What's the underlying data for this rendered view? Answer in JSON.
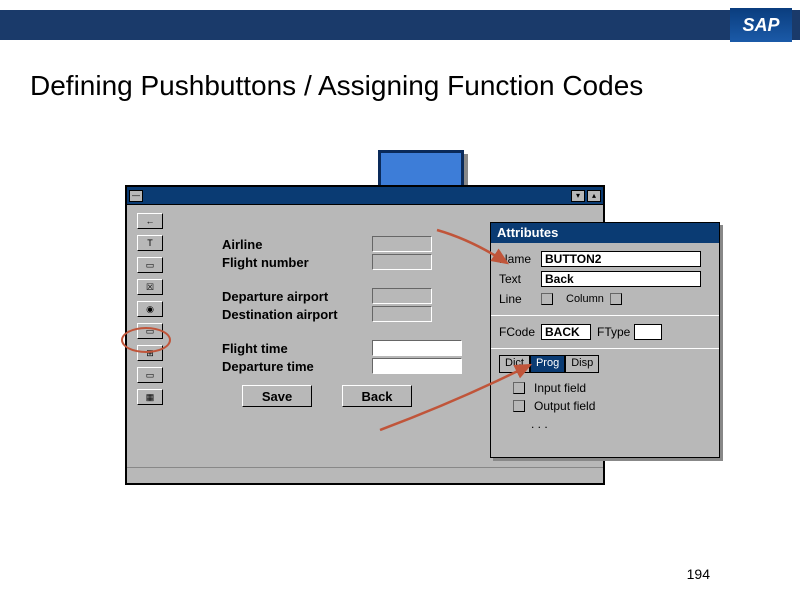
{
  "brand": "SAP",
  "slide_title": "Defining Pushbuttons / Assigning Function Codes",
  "page_number": "194",
  "form": {
    "fields": {
      "airline": "Airline",
      "flight_number": "Flight number",
      "dep_airport": "Departure airport",
      "dest_airport": "Destination airport",
      "flight_time": "Flight time",
      "dep_time": "Departure time"
    },
    "buttons": {
      "save": "Save",
      "back": "Back"
    }
  },
  "attributes": {
    "panel_title": "Attributes",
    "labels": {
      "name": "Name",
      "text": "Text",
      "line": "Line",
      "column": "Column",
      "fcode": "FCode",
      "ftype": "FType"
    },
    "values": {
      "name": "BUTTON2",
      "text": "Back",
      "fcode": "BACK",
      "ftype": ""
    },
    "tabs": {
      "dict": "Dict",
      "prog": "Prog",
      "disp": "Disp"
    },
    "options": {
      "input_field": "Input field",
      "output_field": "Output field",
      "more": ". . ."
    }
  },
  "toolbar_icons": [
    "arrow-left",
    "text",
    "frame",
    "checkbox",
    "radio",
    "button",
    "layout",
    "rect",
    "table"
  ]
}
